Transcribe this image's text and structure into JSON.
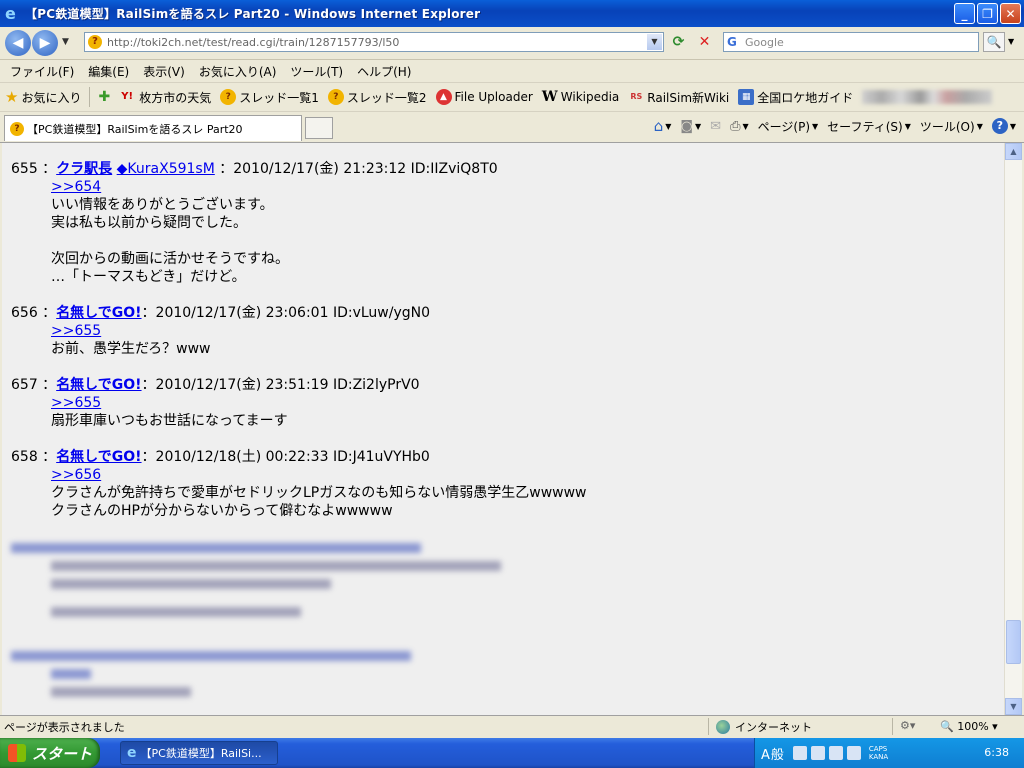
{
  "window": {
    "title": "【PC鉄道模型】RailSimを語るスレ Part20 - Windows Internet Explorer",
    "minimize": "_",
    "maximize": "❐",
    "close": "✕"
  },
  "address": {
    "url": "http://toki2ch.net/test/read.cgi/train/1287157793/l50",
    "search_placeholder": "Google"
  },
  "menu": [
    "ファイル(F)",
    "編集(E)",
    "表示(V)",
    "お気に入り(A)",
    "ツール(T)",
    "ヘルプ(H)"
  ],
  "favorites": {
    "label": "お気に入り",
    "items": [
      {
        "label": "枚方市の天気",
        "icon": "yahoo-icon"
      },
      {
        "label": "スレッド一覧1",
        "icon": "thread-icon"
      },
      {
        "label": "スレッド一覧2",
        "icon": "thread-icon"
      },
      {
        "label": "File Uploader",
        "icon": "uploader-icon"
      },
      {
        "label": "Wikipedia",
        "icon": "wikipedia-icon"
      },
      {
        "label": "RailSim新Wiki",
        "icon": "railsim-icon"
      },
      {
        "label": "全国ロケ地ガイド",
        "icon": "map-icon"
      }
    ]
  },
  "tab": {
    "title": "【PC鉄道模型】RailSimを語るスレ Part20"
  },
  "commandbar": {
    "page": "ページ(P)",
    "safety": "セーフティ(S)",
    "tools": "ツール(O)"
  },
  "posts": [
    {
      "num": "655",
      "name": "クラ駅長",
      "trip": "◆KuraX591sM",
      "meta": "2010/12/17(金) 21:23:12 ID:IIZviQ8T0",
      "anchor": ">>654",
      "lines": [
        "いい情報をありがとうございます。",
        "実は私も以前から疑問でした。",
        "",
        "次回からの動画に活かせそうですね。",
        "…「トーマスもどき」だけど。"
      ]
    },
    {
      "num": "656",
      "name": "名無しでGO!",
      "trip": "",
      "meta": "2010/12/17(金) 23:06:01 ID:vLuw/ygN0",
      "anchor": ">>655",
      "lines": [
        "お前、愚学生だろ？www"
      ]
    },
    {
      "num": "657",
      "name": "名無しでGO!",
      "trip": "",
      "meta": "2010/12/17(金) 23:51:19 ID:Zi2lyPrV0",
      "anchor": ">>655",
      "lines": [
        "扇形車庫いつもお世話になってまーす"
      ]
    },
    {
      "num": "658",
      "name": "名無しでGO!",
      "trip": "",
      "meta": "2010/12/18(土) 00:22:33 ID:J41uVYHb0",
      "anchor": ">>656",
      "lines": [
        "クラさんが免許持ちで愛車がセドリックLPガスなのも知らない情弱愚学生乙wwwww",
        "クラさんのHPが分からないからって僻むなよwwwww"
      ]
    }
  ],
  "status": {
    "text": "ページが表示されました",
    "zone": "インターネット",
    "zoom": "100%"
  },
  "taskbar": {
    "start": "スタート",
    "task": "【PC鉄道模型】RailSi...",
    "ime": "A般",
    "caps": "CAPS",
    "kana": "KANA",
    "clock": "6:38"
  }
}
